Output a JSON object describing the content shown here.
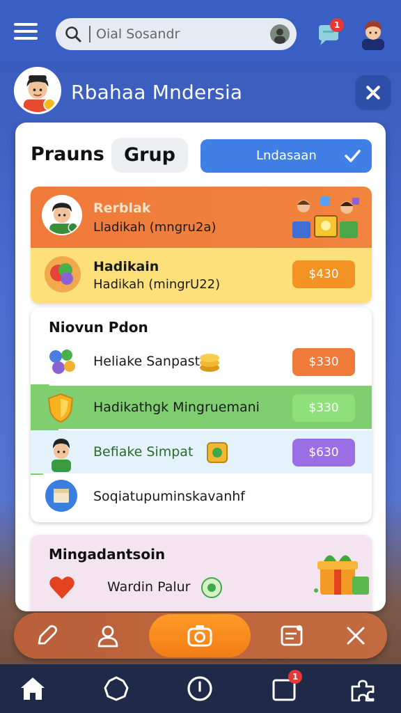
{
  "topbar": {
    "search_placeholder": "Oial Sosandr",
    "chat_badge": "1"
  },
  "header": {
    "title": "Rbahaa Mndersia"
  },
  "tabs": {
    "tab1": "Prauns",
    "tab2": "Grup"
  },
  "select": {
    "value": "Lndasaan"
  },
  "card1": {
    "row1": {
      "title": "Rerblak",
      "subtitle": "Lladikah (mngru2a)"
    },
    "row2": {
      "title": "Hadikain",
      "subtitle": "Hadikah (mingrU22)",
      "price": "$430"
    }
  },
  "card2": {
    "title": "Niovun Pdon",
    "items": [
      {
        "label": "Heliake Sanpast",
        "price": "$330"
      },
      {
        "label": "Hadikathgk Mingruemani",
        "price": "$330"
      },
      {
        "label": "Befiake Simpat",
        "price": "$630"
      },
      {
        "label": "Soqiatupuminskavanhf"
      }
    ]
  },
  "card3": {
    "title": "Mingadantsoin",
    "item_label": "Wardin Palur"
  },
  "colors": {
    "brand_blue": "#3a5fc4",
    "orange": "#f07a3a",
    "yellow": "#fde07a",
    "green": "#7ad06a",
    "light_blue": "#e3f2fb",
    "purple": "#9b6ee6"
  },
  "bottomnav": {
    "inbox_badge": "1"
  },
  "icons": [
    "menu-icon",
    "search-icon",
    "chat-icon",
    "close-icon",
    "check-icon",
    "pencil-icon",
    "user-icon",
    "camera-icon",
    "note-icon",
    "x-icon",
    "home-icon",
    "explore-icon",
    "compass-icon",
    "inbox-icon",
    "puzzle-icon"
  ]
}
